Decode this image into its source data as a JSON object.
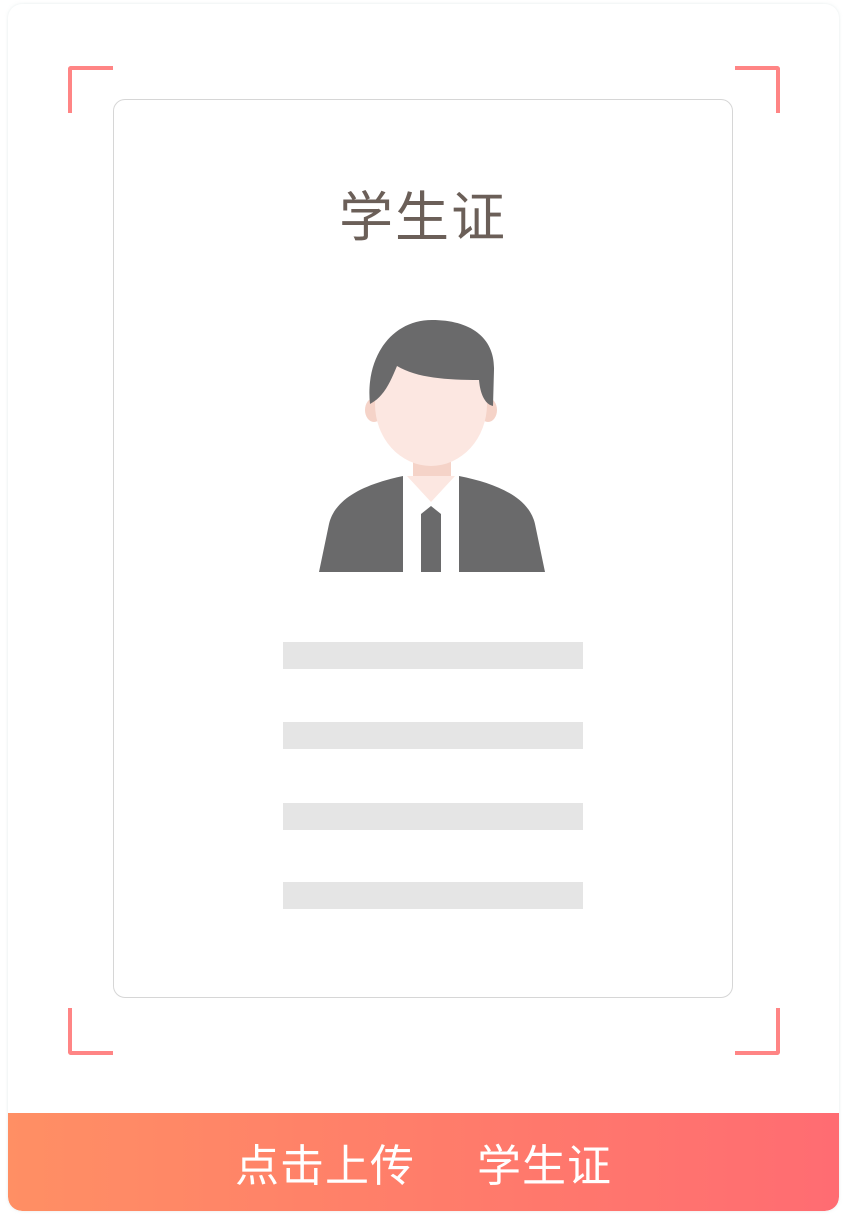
{
  "card": {
    "title": "学生证"
  },
  "upload_button": {
    "action_label": "点击上传",
    "document_label": "学生证"
  },
  "colors": {
    "corner_accent": "#ff8585",
    "button_gradient_start": "#ff8f64",
    "button_gradient_end": "#ff6c72",
    "title_text": "#6b5f58",
    "placeholder_line": "#e5e5e5",
    "avatar_hair_suit": "#6a6a6b",
    "avatar_skin": "#fce7e1"
  },
  "icons": {
    "avatar": "person-avatar-icon"
  }
}
